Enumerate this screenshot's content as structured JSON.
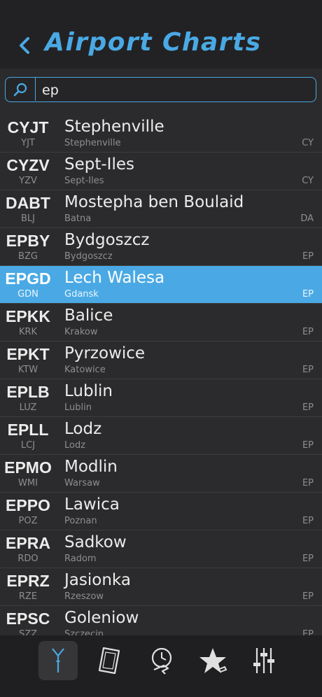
{
  "header": {
    "title": "Airport Charts"
  },
  "search": {
    "value": "ep",
    "placeholder": ""
  },
  "airports": [
    {
      "icao": "CYJT",
      "iata": "YJT",
      "name": "Stephenville",
      "city": "Stephenville",
      "country": "CY"
    },
    {
      "icao": "CYZV",
      "iata": "YZV",
      "name": "Sept-Iles",
      "city": "Sept-Iles",
      "country": "CY"
    },
    {
      "icao": "DABT",
      "iata": "BLJ",
      "name": "Mostepha ben Boulaid",
      "city": "Batna",
      "country": "DA"
    },
    {
      "icao": "EPBY",
      "iata": "BZG",
      "name": "Bydgoszcz",
      "city": "Bydgoszcz",
      "country": "EP"
    },
    {
      "icao": "EPGD",
      "iata": "GDN",
      "name": "Lech Walesa",
      "city": "Gdansk",
      "country": "EP",
      "selected": true
    },
    {
      "icao": "EPKK",
      "iata": "KRK",
      "name": "Balice",
      "city": "Krakow",
      "country": "EP"
    },
    {
      "icao": "EPKT",
      "iata": "KTW",
      "name": "Pyrzowice",
      "city": "Katowice",
      "country": "EP"
    },
    {
      "icao": "EPLB",
      "iata": "LUZ",
      "name": "Lublin",
      "city": "Lublin",
      "country": "EP"
    },
    {
      "icao": "EPLL",
      "iata": "LCJ",
      "name": "Lodz",
      "city": "Lodz",
      "country": "EP"
    },
    {
      "icao": "EPMO",
      "iata": "WMI",
      "name": "Modlin",
      "city": "Warsaw",
      "country": "EP"
    },
    {
      "icao": "EPPO",
      "iata": "POZ",
      "name": "Lawica",
      "city": "Poznan",
      "country": "EP"
    },
    {
      "icao": "EPRA",
      "iata": "RDO",
      "name": "Sadkow",
      "city": "Radom",
      "country": "EP"
    },
    {
      "icao": "EPRZ",
      "iata": "RZE",
      "name": "Jasionka",
      "city": "Rzeszow",
      "country": "EP"
    },
    {
      "icao": "EPSC",
      "iata": "SZZ",
      "name": "Goleniow",
      "city": "Szczecin",
      "country": "EP"
    }
  ],
  "tabs": [
    {
      "icon": "runway-icon",
      "active": true
    },
    {
      "icon": "chart-icon",
      "active": false
    },
    {
      "icon": "recent-flights-icon",
      "active": false
    },
    {
      "icon": "favorites-icon",
      "active": false
    },
    {
      "icon": "settings-sliders-icon",
      "active": false
    }
  ],
  "colors": {
    "accent": "#4aa9e4",
    "background": "#2b2b2d",
    "header": "#222224",
    "tabbar": "#1f1f21"
  }
}
